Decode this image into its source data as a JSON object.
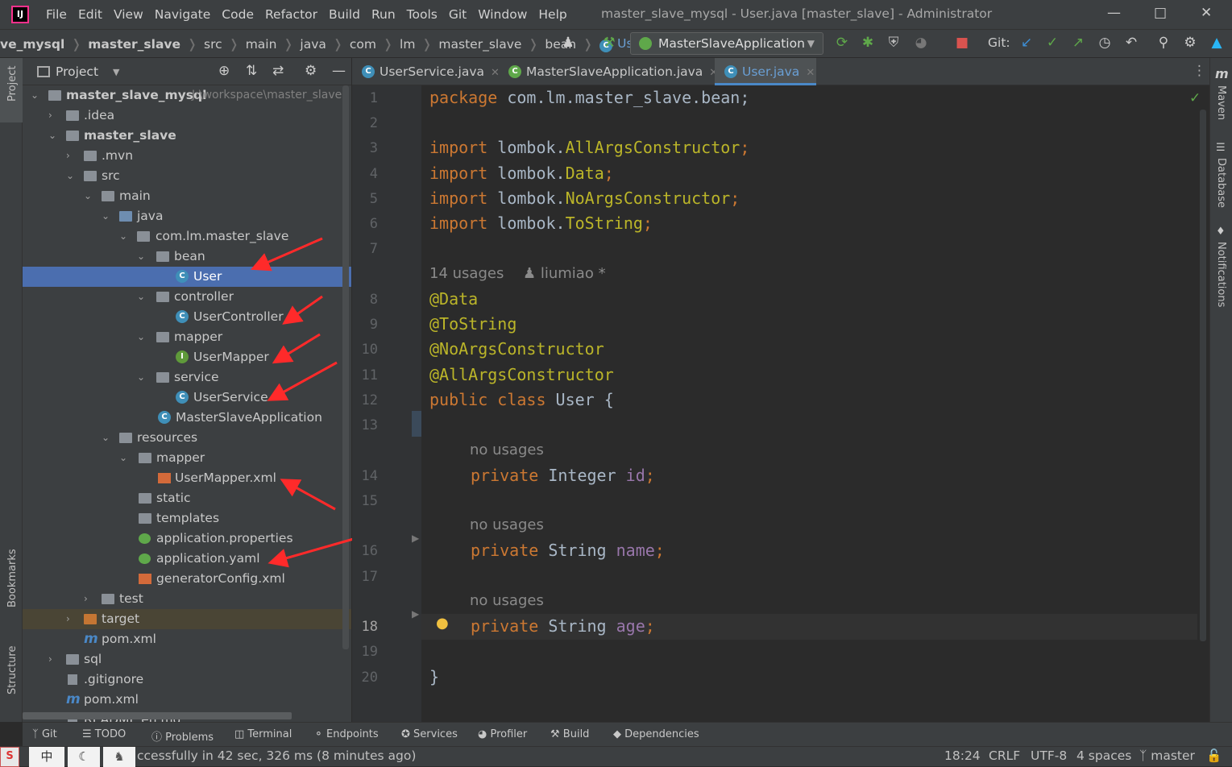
{
  "window": {
    "title": "master_slave_mysql - User.java [master_slave] - Administrator"
  },
  "menu": [
    "File",
    "Edit",
    "View",
    "Navigate",
    "Code",
    "Refactor",
    "Build",
    "Run",
    "Tools",
    "Git",
    "Window",
    "Help"
  ],
  "breadcrumb": [
    "ve_mysql",
    "master_slave",
    "src",
    "main",
    "java",
    "com",
    "lm",
    "master_slave",
    "bean",
    "User"
  ],
  "toolbar": {
    "run_config": "MasterSlaveApplication",
    "git_label": "Git:"
  },
  "project_panel": {
    "title": "Project",
    "root_name": "master_slave_mysql",
    "root_path": "J:\\workspace\\master_slave",
    "tree": [
      "master_slave_mysql",
      ".idea",
      "master_slave",
      ".mvn",
      "src",
      "main",
      "java",
      "com.lm.master_slave",
      "bean",
      "User",
      "controller",
      "UserController",
      "mapper",
      "UserMapper",
      "service",
      "UserService",
      "MasterSlaveApplication",
      "resources",
      "mapper",
      "UserMapper.xml",
      "static",
      "templates",
      "application.properties",
      "application.yaml",
      "generatorConfig.xml",
      "test",
      "target",
      "pom.xml",
      "sql",
      ".gitignore",
      "pom.xml",
      "README.en.md"
    ]
  },
  "left_stripe": [
    "Project",
    "Bookmarks",
    "Structure"
  ],
  "right_stripe": [
    "Maven",
    "Database",
    "Notifications"
  ],
  "tabs": [
    {
      "label": "UserService.java"
    },
    {
      "label": "MasterSlaveApplication.java"
    },
    {
      "label": "User.java"
    }
  ],
  "editor": {
    "line_numbers": [
      "1",
      "2",
      "3",
      "4",
      "5",
      "6",
      "7",
      "8",
      "9",
      "10",
      "11",
      "12",
      "13",
      "14",
      "15",
      "16",
      "17",
      "18",
      "19",
      "20"
    ],
    "code": {
      "l1_kw": "package",
      "l1_rest": " com.lm.master_slave.bean;",
      "l3_kw": "import",
      "l3_pkg": " lombok.",
      "l3_cls": "AllArgsConstructor",
      "l4_cls": "Data",
      "l5_cls": "NoArgsConstructor",
      "l6_cls": "ToString",
      "semi": ";",
      "hint_usages": "14 usages",
      "hint_author": "liumiao *",
      "a1": "@Data",
      "a2": "@ToString",
      "a3": "@NoArgsConstructor",
      "a4": "@AllArgsConstructor",
      "l12_kw": "public class",
      "l12_rest": " User {",
      "no_usages": "no usages",
      "private": "private",
      "t_integer": " Integer ",
      "t_string": " String ",
      "f_id": "id",
      "f_name": "name",
      "f_age": "age",
      "close": "}"
    }
  },
  "tool_windows": [
    "Git",
    "TODO",
    "Problems",
    "Terminal",
    "Endpoints",
    "Services",
    "Profiler",
    "Build",
    "Dependencies"
  ],
  "status": {
    "message": "ccessfully in 42 sec, 326 ms (8 minutes ago)",
    "position": "18:24",
    "line_sep": "CRLF",
    "encoding": "UTF-8",
    "indent": "4 spaces",
    "branch": "master",
    "ime": "中"
  },
  "colors": {
    "accent": "#4a88c7",
    "selection": "#4b6eaf",
    "keyword": "#cc7832",
    "annotation": "#bbb529",
    "field": "#9876aa",
    "arrow": "#ff2a2a"
  }
}
